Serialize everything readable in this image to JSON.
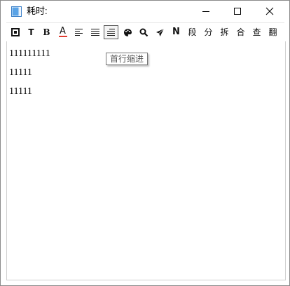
{
  "window": {
    "title": "耗时:",
    "minimize_label": "Minimize",
    "maximize_label": "Maximize",
    "close_label": "Close"
  },
  "toolbar": {
    "buttons": [
      {
        "name": "border-box-button",
        "icon": "border-box-icon",
        "label": ""
      },
      {
        "name": "text-button",
        "icon": "text-t-icon",
        "label": "T"
      },
      {
        "name": "bold-button",
        "icon": "bold-b-icon",
        "label": "B"
      },
      {
        "name": "font-color-button",
        "icon": "font-color-a-icon",
        "label": "A",
        "color": "#e03c31"
      },
      {
        "name": "align-left-button",
        "icon": "align-left-icon",
        "label": ""
      },
      {
        "name": "justify-button",
        "icon": "justify-icon",
        "label": ""
      },
      {
        "name": "first-line-indent-button",
        "icon": "first-line-indent-icon",
        "label": "",
        "active": true
      },
      {
        "name": "palette-button",
        "icon": "palette-icon",
        "label": ""
      },
      {
        "name": "search-button",
        "icon": "search-icon",
        "label": ""
      },
      {
        "name": "send-button",
        "icon": "send-icon",
        "label": ""
      },
      {
        "name": "n-button",
        "icon": "n-icon",
        "label": "N"
      },
      {
        "name": "paragraph-button",
        "icon": "",
        "label": "段"
      },
      {
        "name": "divide-button",
        "icon": "",
        "label": "分"
      },
      {
        "name": "split-button",
        "icon": "",
        "label": "拆"
      },
      {
        "name": "merge-button",
        "icon": "",
        "label": "合"
      },
      {
        "name": "check-button",
        "icon": "",
        "label": "查"
      },
      {
        "name": "translate-button",
        "icon": "",
        "label": "翻"
      }
    ]
  },
  "tooltip": {
    "text": "首行缩进"
  },
  "editor": {
    "lines": [
      "111111111",
      "11111",
      "11111"
    ]
  },
  "colors": {
    "font_color_underline": "#e03c31",
    "app_icon_blue": "#2f7fd3"
  }
}
